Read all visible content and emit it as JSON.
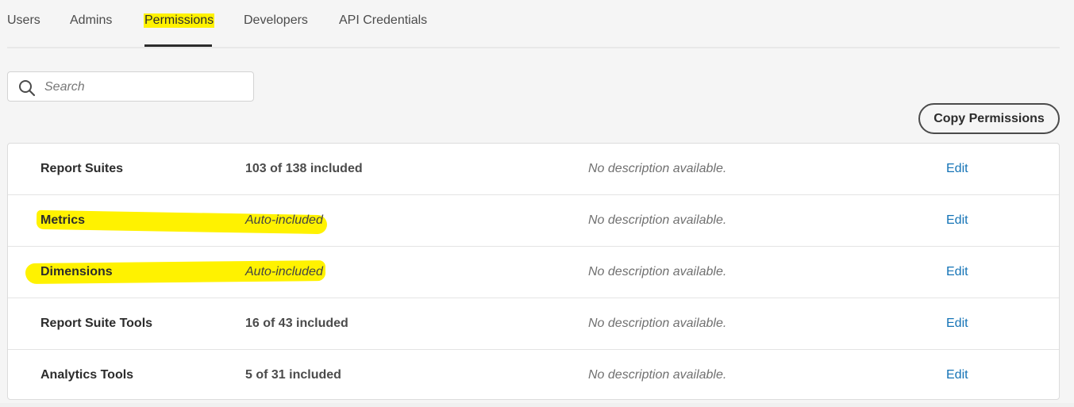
{
  "tabs": [
    {
      "label": "Users"
    },
    {
      "label": "Admins"
    },
    {
      "label": "Permissions",
      "active": true
    },
    {
      "label": "Developers"
    },
    {
      "label": "API Credentials"
    }
  ],
  "search": {
    "placeholder": "Search",
    "value": ""
  },
  "copy_button": {
    "label": "Copy Permissions"
  },
  "rows": [
    {
      "name": "Report Suites",
      "count": "103 of 138 included",
      "description": "No description available.",
      "action": "Edit"
    },
    {
      "name": "Metrics",
      "count": "Auto-included",
      "description": "No description available.",
      "action": "Edit"
    },
    {
      "name": "Dimensions",
      "count": "Auto-included",
      "description": "No description available.",
      "action": "Edit"
    },
    {
      "name": "Report Suite Tools",
      "count": "16 of 43 included",
      "description": "No description available.",
      "action": "Edit"
    },
    {
      "name": "Analytics Tools",
      "count": "5 of 31 included",
      "description": "No description available.",
      "action": "Edit"
    }
  ],
  "colors": {
    "highlight": "#fff200",
    "link": "#1473b6"
  }
}
